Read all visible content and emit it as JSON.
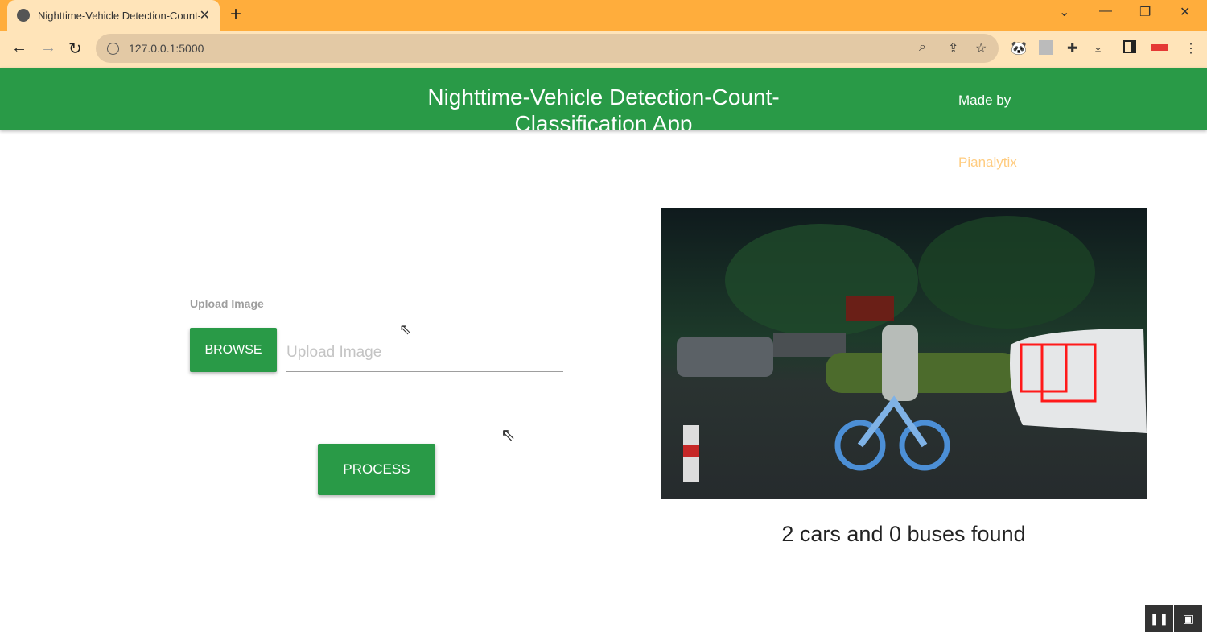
{
  "browser": {
    "tab_title": "Nighttime-Vehicle Detection-Count-Classification App",
    "new_tab": "+",
    "url": "127.0.0.1:5000"
  },
  "header": {
    "title": "Nighttime-Vehicle Detection-Count-Classification App",
    "made_by": "Made by",
    "author": "Pianalytix"
  },
  "form": {
    "upload_label": "Upload Image",
    "browse_label": "BROWSE",
    "upload_placeholder": "Upload Image",
    "process_label": "PROCESS"
  },
  "result": {
    "text": "2 cars and 0 buses found",
    "detections": 2
  },
  "colors": {
    "primary": "#299a47",
    "accent": "#ffcc80",
    "tabbar": "#ffad3c"
  }
}
